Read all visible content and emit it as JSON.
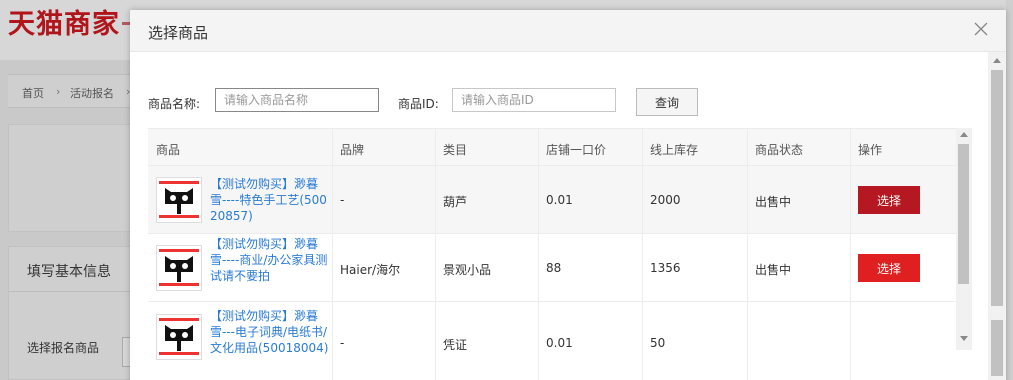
{
  "background": {
    "logo": "天猫商家",
    "breadcrumb": [
      "首页",
      "活动报名"
    ],
    "section_title": "填写基本信息",
    "section_label": "选择报名商品"
  },
  "modal": {
    "title": "选择商品",
    "filter": {
      "name_label": "商品名称:",
      "name_placeholder": "请输入商品名称",
      "id_label": "商品ID:",
      "id_placeholder": "请输入商品ID",
      "query_button": "查询"
    },
    "table": {
      "headers": [
        "商品",
        "品牌",
        "类目",
        "店铺一口价",
        "线上库存",
        "商品状态",
        "操作"
      ],
      "rows": [
        {
          "name": "【测试勿购买】渺暮雪----特色手工艺(50020857)",
          "brand": "-",
          "category": "葫芦",
          "price": "0.01",
          "stock": "2000",
          "status": "出售中",
          "action": "选择"
        },
        {
          "name": "【测试勿购买】渺暮雪----商业/办公家具测试请不要拍",
          "brand": "Haier/海尔",
          "category": "景观小品",
          "price": "88",
          "stock": "1356",
          "status": "出售中",
          "action": "选择"
        },
        {
          "name": "【测试勿购买】渺暮雪---电子词典/电纸书/文化用品(50018004)",
          "brand": "-",
          "category": "凭证",
          "price": "0.01",
          "stock": "50",
          "status": "",
          "action": ""
        }
      ]
    }
  },
  "colors": {
    "brand_red": "#b1151c",
    "select_dark": "#b51820",
    "select_bright": "#e02020",
    "link_blue": "#2a7bd6"
  },
  "icons": {
    "close": "close-icon",
    "product_thumb": "tmall-cat-icon"
  }
}
